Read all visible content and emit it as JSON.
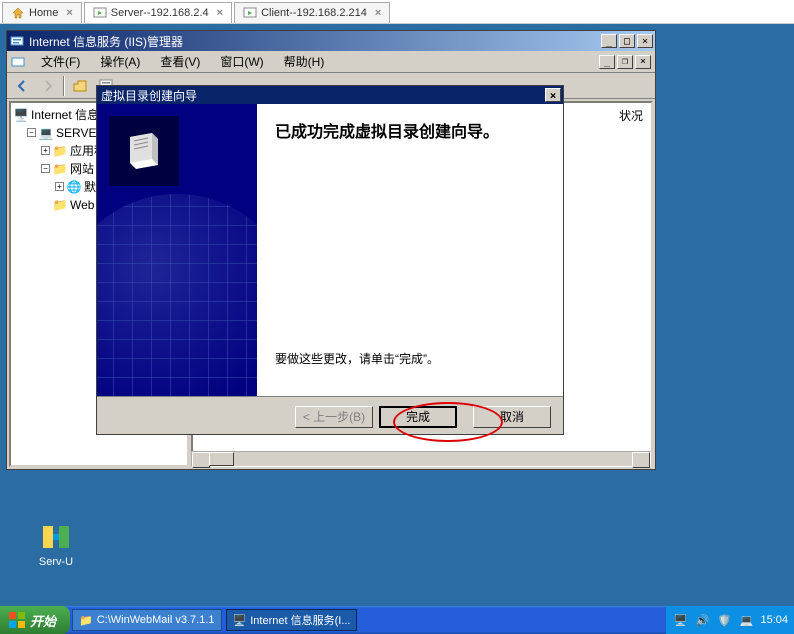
{
  "browser_tabs": [
    {
      "label": "Home",
      "icon": "home"
    },
    {
      "label": "Server--192.168.2.4",
      "icon": "vm-play",
      "active": true
    },
    {
      "label": "Client--192.168.2.214",
      "icon": "vm-play"
    }
  ],
  "iis": {
    "title": "Internet 信息服务 (IIS)管理器",
    "menu": {
      "file": "文件(F)",
      "action": "操作(A)",
      "view": "查看(V)",
      "window": "窗口(W)",
      "help": "帮助(H)"
    },
    "tree": {
      "root": "Internet 信息服务",
      "server": "SERVER (本地计算机)",
      "app_pool": "应用程序池",
      "website": "网站",
      "default_site": "默认网站",
      "web_ext": "Web 服务扩展"
    },
    "right_col_header": "状况"
  },
  "wizard": {
    "title": "虚拟目录创建向导",
    "heading": "已成功完成虚拟目录创建向导。",
    "note": "要做这些更改，请单击“完成”。",
    "back": "< 上一步(B)",
    "finish": "完成",
    "cancel": "取消"
  },
  "desktop": {
    "servu": "Serv-U"
  },
  "taskbar": {
    "start": "开始",
    "items": [
      {
        "label": "C:\\WinWebMail v3.7.1.1",
        "icon": "folder"
      },
      {
        "label": "Internet 信息服务(I...",
        "icon": "iis",
        "active": true
      }
    ],
    "time": "15:04"
  }
}
